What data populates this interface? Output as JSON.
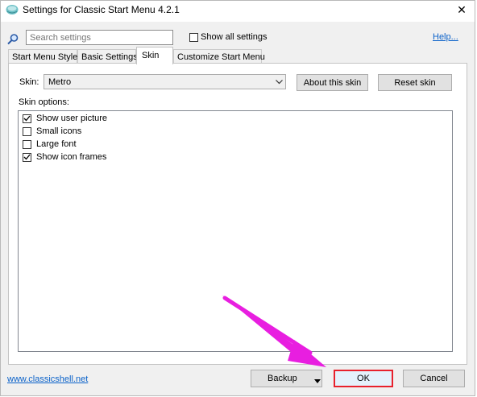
{
  "window": {
    "title": "Settings for Classic Start Menu 4.2.1",
    "close_glyph": "✕"
  },
  "search": {
    "placeholder": "Search settings",
    "show_all_label": "Show all settings",
    "show_all_checked": false,
    "help_label": "Help..."
  },
  "tabs": [
    {
      "label": "Start Menu Style",
      "active": false
    },
    {
      "label": "Basic Settings",
      "active": false
    },
    {
      "label": "Skin",
      "active": true
    },
    {
      "label": "Customize Start Menu",
      "active": false
    }
  ],
  "skin": {
    "label": "Skin:",
    "selected": "Metro",
    "about_label": "About this skin",
    "reset_label": "Reset skin",
    "options_label": "Skin options:",
    "options": [
      {
        "label": "Show user picture",
        "checked": true
      },
      {
        "label": "Small icons",
        "checked": false
      },
      {
        "label": "Large font",
        "checked": false
      },
      {
        "label": "Show icon frames",
        "checked": true
      }
    ]
  },
  "footer": {
    "link": "www.classicshell.net",
    "backup_label": "Backup",
    "ok_label": "OK",
    "cancel_label": "Cancel"
  },
  "colors": {
    "link": "#0b62c9",
    "ok_highlight": "#e8212c",
    "annotation_arrow": "#e81ee0"
  },
  "icons": {
    "app": "classic-shell-icon",
    "search": "search-icon",
    "close": "close-icon",
    "dropdown": "chevron-down-icon",
    "check": "checkmark-icon"
  }
}
